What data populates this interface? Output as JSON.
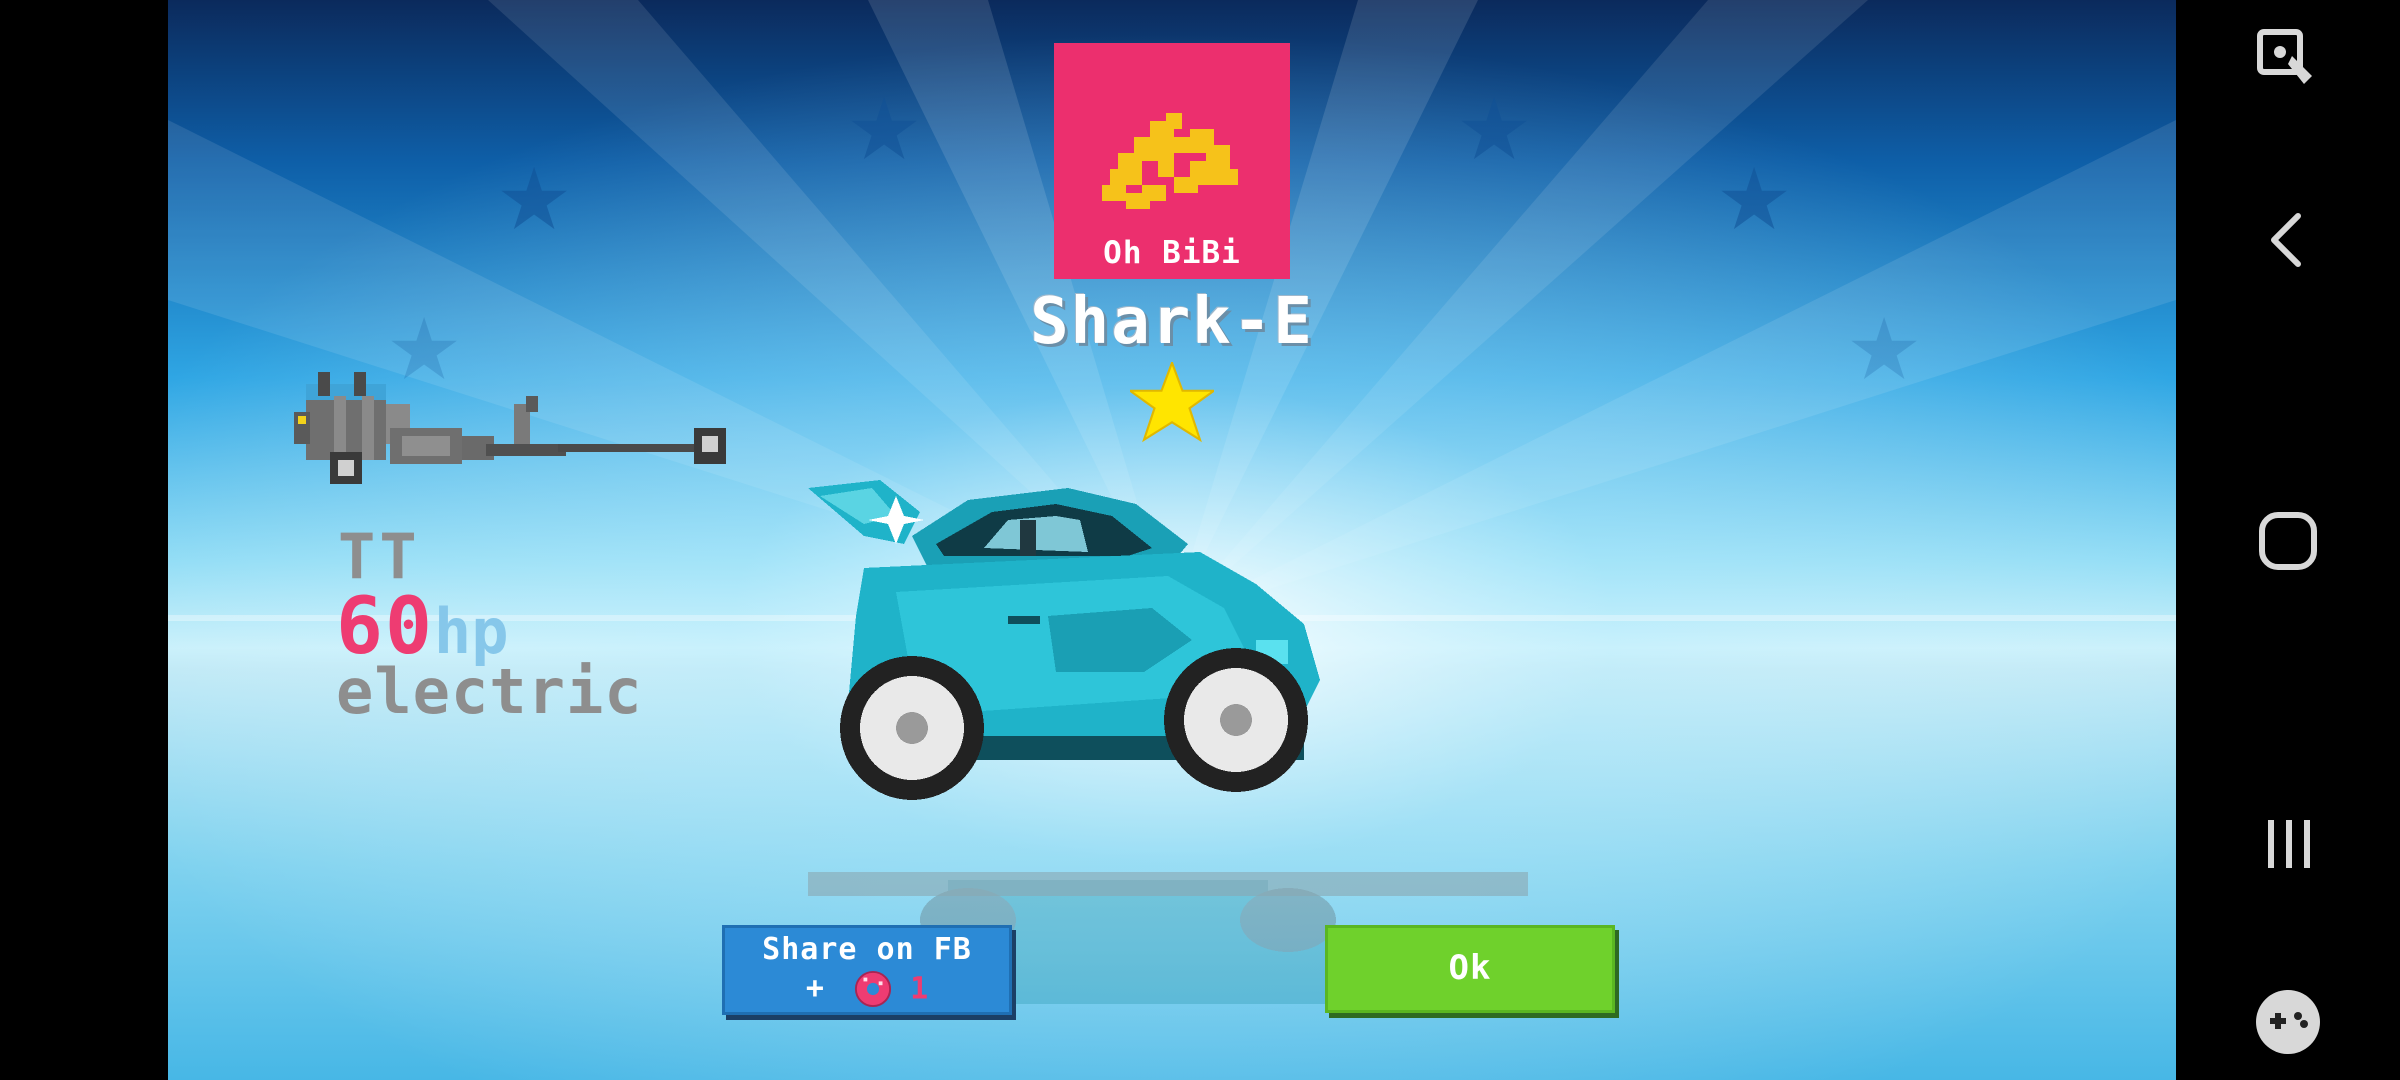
{
  "sponsor": {
    "name": "Oh BiBi",
    "card_color": "#ec2f6e",
    "logo_color": "#f6c21a"
  },
  "car": {
    "name": "Shark-E",
    "stars": 1,
    "body_color": "#1fb3c9"
  },
  "engine": {
    "name": "TT",
    "power_value": "60",
    "power_unit": "hp",
    "fuel_type": "electric"
  },
  "buttons": {
    "share_label": "Share on FB",
    "share_plus": "+",
    "share_reward_amount": "1",
    "share_reward_icon": "donut-icon",
    "ok_label": "Ok"
  },
  "colors": {
    "share_button": "#2c8ad6",
    "ok_button": "#6fd12c",
    "power_value": "#ee3c72",
    "star": "#ffe500"
  },
  "nav": {
    "items": [
      "screen-lock-icon",
      "back-icon",
      "home-icon",
      "recents-icon",
      "game-tools-icon"
    ]
  }
}
